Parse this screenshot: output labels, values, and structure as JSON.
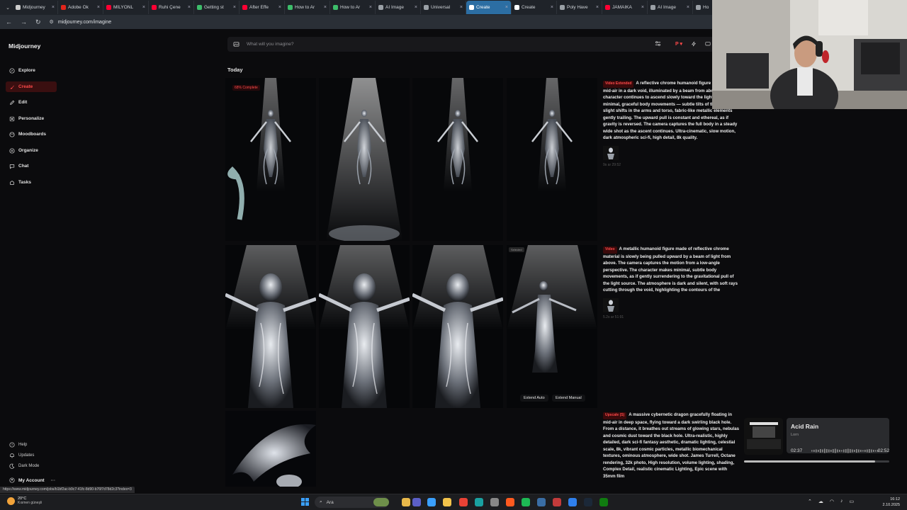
{
  "browser": {
    "tabs": [
      {
        "label": "Midjourney",
        "color": "#cccccc"
      },
      {
        "label": "Adobe Ök",
        "color": "#e1251b"
      },
      {
        "label": "MİLYONL",
        "color": "#ff0033"
      },
      {
        "label": "Ruhi Çene",
        "color": "#ff0033"
      },
      {
        "label": "Getting st",
        "color": "#3dbd6a"
      },
      {
        "label": "After Effe",
        "color": "#ff0033"
      },
      {
        "label": "How to Ar",
        "color": "#3dbd6a"
      },
      {
        "label": "How to Ar",
        "color": "#3dbd6a"
      },
      {
        "label": "AI Image",
        "color": "#9aa0a6"
      },
      {
        "label": "Universal",
        "color": "#9aa0a6"
      },
      {
        "label": "Create",
        "color": "#ffffff",
        "active": true
      },
      {
        "label": "Create",
        "color": "#ffffff"
      },
      {
        "label": "Poly Have",
        "color": "#9aa0a6"
      },
      {
        "label": "JAMAIKA",
        "color": "#ff0033"
      },
      {
        "label": "AI Image",
        "color": "#9aa0a6"
      },
      {
        "label": "Ho",
        "color": "#9aa0a6"
      }
    ],
    "url": "midjourney.com/imagine"
  },
  "sidebar": {
    "logo": "Midjourney",
    "items": [
      {
        "label": "Explore",
        "icon": "compass-icon"
      },
      {
        "label": "Create",
        "icon": "brush-icon",
        "active": true
      },
      {
        "label": "Edit",
        "icon": "edit-icon"
      },
      {
        "label": "Personalize",
        "icon": "personalize-icon"
      },
      {
        "label": "Moodboards",
        "icon": "moodboard-icon"
      },
      {
        "label": "Organize",
        "icon": "folder-icon"
      },
      {
        "label": "Chat",
        "icon": "chat-icon"
      },
      {
        "label": "Tasks",
        "icon": "tasks-icon"
      }
    ],
    "footer": [
      {
        "label": "Help",
        "icon": "help-icon"
      },
      {
        "label": "Updates",
        "icon": "bell-icon"
      },
      {
        "label": "Dark Mode",
        "icon": "moon-icon"
      }
    ],
    "account": "My Account",
    "account_more": "···"
  },
  "prompt_bar": {
    "placeholder": "What will you imagine?"
  },
  "section_title": "Today",
  "row1": {
    "badge": "68% Complete"
  },
  "row2": {
    "badge": "Selected",
    "extend_auto": "Extend Auto",
    "extend_manual": "Extend Manual"
  },
  "cards": [
    {
      "tag": "Video Extended",
      "text": "A reflective chrome humanoid figure suspended mid-air in a dark void, illuminated by a beam from above. The character continues to ascend slowly toward the light source with minimal, graceful body movements — subtle tilts of the head, slight shifts in the arms and torso, fabric-like metallic elements gently trailing. The upward pull is constant and ethereal, as if gravity is reversed. The camera captures the full body in a steady wide shot as the ascent continues. Ultra-cinematic, slow motion, dark atmospheric sci-fi, high detail, 8k quality.",
      "meta": "9s   ar 29:52"
    },
    {
      "tag": "Video",
      "text": "A metallic humanoid figure made of reflective chrome material is slowly being pulled upward by a beam of light from above. The camera captures the motion from a low-angle perspective. The character makes minimal, subtle body movements, as if gently surrendering to the gravitational pull of the light source. The atmosphere is dark and silent, with soft rays cutting through the void, highlighting the contours of the",
      "meta": "5.2s   ar 51:91"
    },
    {
      "tag": "Upscale (S)",
      "text": "A massive cybernetic dragon gracefully floating in mid-air in deep space, flying toward a dark swirling black hole. From a distance, it breathes out streams of glowing stars, nebulas and cosmic dust toward the black hole. Ultra-realistic, highly detailed, dark sci-fi fantasy aesthetic, dramatic lighting, celestial scale, 8k, vibrant cosmic particles, metallic biomechanical textures, ominous atmosphere, wide shot. James Turrell, Octane rendering, 32k photo, High resolution, volume lighting, shading, Complex Detail, realistic cinematic Lighting, Epic scene with 35mm film",
      "meta": ""
    }
  ],
  "music": {
    "title": "Acid Rain",
    "artist": "Lorn",
    "elapsed": "02:37",
    "total": "02:52",
    "progress": 0.9
  },
  "status_url": "https://www.midjourney.com/jobs/b1bf2ac-b9c7-41fc-8d90-b76f7d78d2c3?index=3",
  "taskbar": {
    "weather_temp": "20°C",
    "weather_desc": "Kısmen güneşli",
    "search_label": "Ara",
    "time": "16:12",
    "date": "2.10.2025"
  }
}
